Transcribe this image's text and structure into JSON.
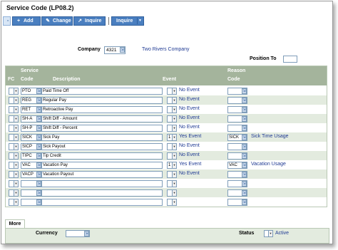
{
  "title": "Service Code (LP08.2)",
  "toolbar": {
    "add": "Add",
    "change": "Change",
    "inquire": "Inquire",
    "inquire_menu": "Inquire"
  },
  "company": {
    "label": "Company",
    "value": "4321",
    "name": "Two Rivers Company"
  },
  "position_to": {
    "label": "Position To",
    "value": ""
  },
  "grid": {
    "headers": {
      "fc": "FC",
      "service": "Service",
      "code": "Code",
      "description": "Description",
      "event": "Event",
      "reason": "Reason",
      "reason_code": "Code"
    },
    "rows": [
      {
        "code": "PTO",
        "description": "Paid Time Off",
        "event_num": "",
        "event_text": "No Event",
        "reason_code": "",
        "reason_text": ""
      },
      {
        "code": "REG",
        "description": "Regular Pay",
        "event_num": "",
        "event_text": "No Event",
        "reason_code": "",
        "reason_text": ""
      },
      {
        "code": "RET",
        "description": "Retroactive Pay",
        "event_num": "",
        "event_text": "No Event",
        "reason_code": "",
        "reason_text": ""
      },
      {
        "code": "SH-A",
        "description": "Shift Diff - Amount",
        "event_num": "",
        "event_text": "No Event",
        "reason_code": "",
        "reason_text": ""
      },
      {
        "code": "SH-P",
        "description": "Shift Diff - Percent",
        "event_num": "",
        "event_text": "No Event",
        "reason_code": "",
        "reason_text": ""
      },
      {
        "code": "SICK",
        "description": "Sick Pay",
        "event_num": "1",
        "event_text": "Yes Event",
        "reason_code": "SICK",
        "reason_text": "Sick Time Usage"
      },
      {
        "code": "SICP",
        "description": "Sick Payout",
        "event_num": "",
        "event_text": "No Event",
        "reason_code": "",
        "reason_text": ""
      },
      {
        "code": "TIPC",
        "description": "Tip Credit",
        "event_num": "",
        "event_text": "No Event",
        "reason_code": "",
        "reason_text": ""
      },
      {
        "code": "VAC",
        "description": "Vacation Pay",
        "event_num": "1",
        "event_text": "Yes Event",
        "reason_code": "VAC",
        "reason_text": "Vacation Usage"
      },
      {
        "code": "VACP",
        "description": "Vacation Payout",
        "event_num": "",
        "event_text": "No Event",
        "reason_code": "",
        "reason_text": ""
      },
      {
        "code": "",
        "description": "",
        "event_num": "",
        "event_text": "",
        "reason_code": "",
        "reason_text": ""
      },
      {
        "code": "",
        "description": "",
        "event_num": "",
        "event_text": "",
        "reason_code": "",
        "reason_text": ""
      },
      {
        "code": "",
        "description": "",
        "event_num": "",
        "event_text": "",
        "reason_code": "",
        "reason_text": ""
      }
    ]
  },
  "more": {
    "tab": "More",
    "currency_label": "Currency",
    "currency_value": "",
    "status_label": "Status",
    "status_value": "Active"
  }
}
